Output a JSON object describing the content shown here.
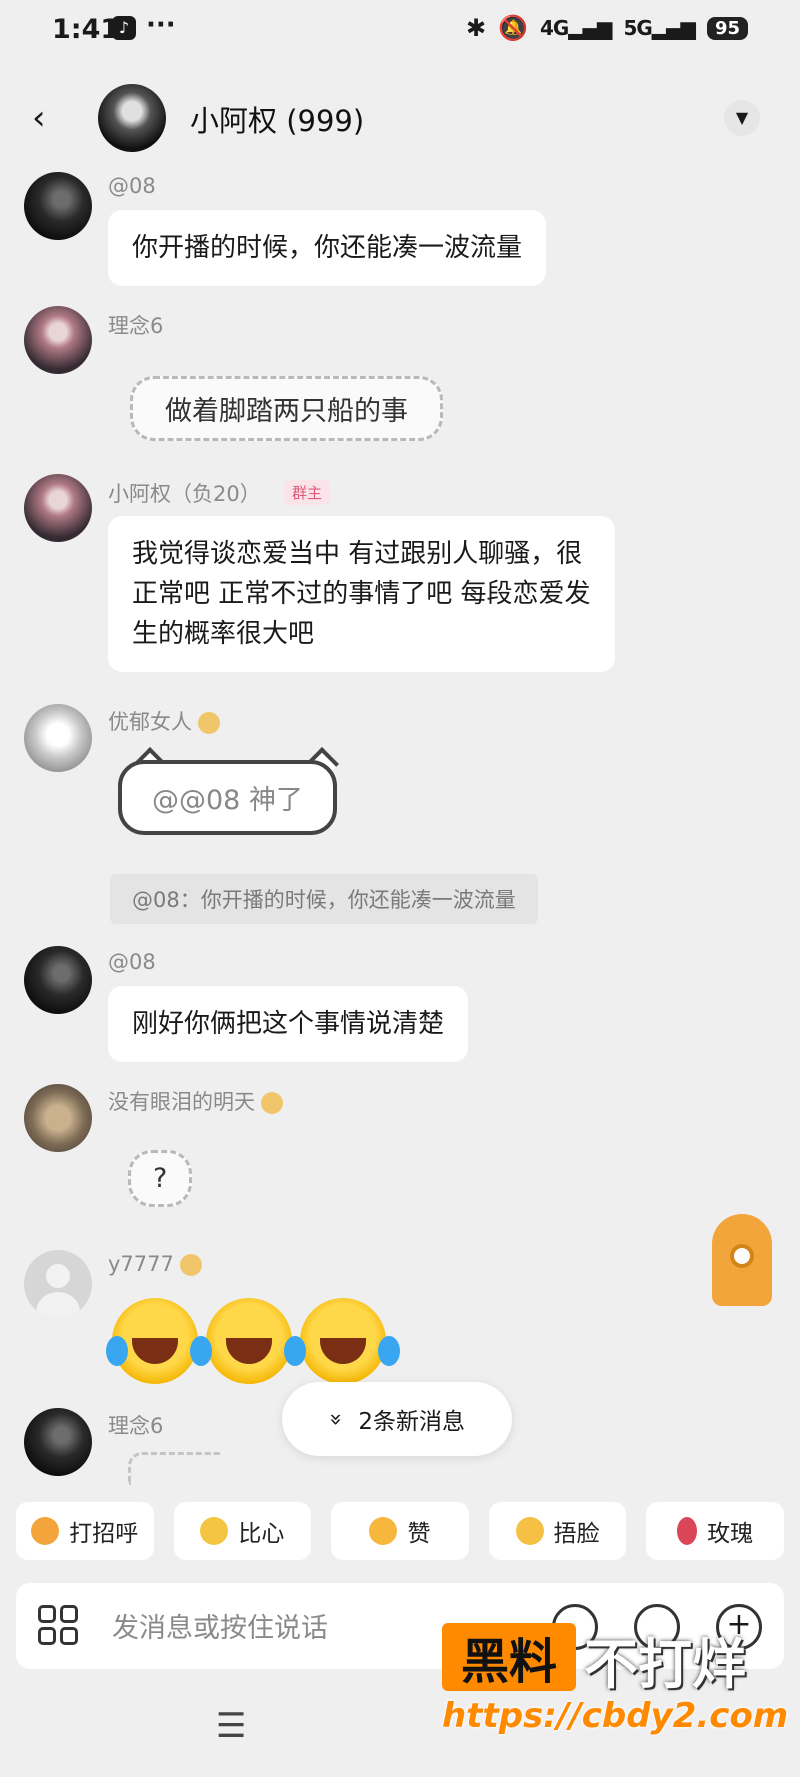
{
  "status_bar": {
    "time": "1:41",
    "dots": "···",
    "net1": "4G",
    "net2": "5G",
    "battery": "95"
  },
  "header": {
    "title": "小阿权 (999)"
  },
  "messages": [
    {
      "name": "@08",
      "text": "你开播的时候，你还能凑一波流量"
    },
    {
      "name": "理念6",
      "text": "做着脚踏两只船的事"
    },
    {
      "name": "小阿权（负20）",
      "badge": "群主",
      "lines": [
        "我觉得谈恋爱当中 有过跟别人聊骚，很",
        "正常吧 正常不过的事情了吧 每段恋爱发",
        "生的概率很大吧"
      ]
    },
    {
      "name": "优郁女人",
      "text": "@@08 神了",
      "quote": "@08：你开播的时候，你还能凑一波流量"
    },
    {
      "name": "@08",
      "text": "刚好你俩把这个事情说清楚"
    },
    {
      "name": "没有眼泪的明天",
      "text": "?"
    },
    {
      "name": "y7777"
    },
    {
      "name": "理念6"
    }
  ],
  "new_messages": {
    "icon": "»",
    "label": "2条新消息"
  },
  "quick_replies": [
    {
      "label": "打招呼",
      "icon_color": "#f3a53c"
    },
    {
      "label": "比心",
      "icon_color": "#f4c542"
    },
    {
      "label": "赞",
      "icon_color": "#f6b73c"
    },
    {
      "label": "捂脸",
      "icon_color": "#f5c043"
    },
    {
      "label": "玫瑰",
      "icon_color": "#d9465a"
    }
  ],
  "input": {
    "placeholder": "发消息或按住说话"
  },
  "nav": {
    "menu_glyph": "☰"
  },
  "watermark": {
    "box": "黑料",
    "text": "不打烊",
    "url": "https://cbdy2.com"
  }
}
